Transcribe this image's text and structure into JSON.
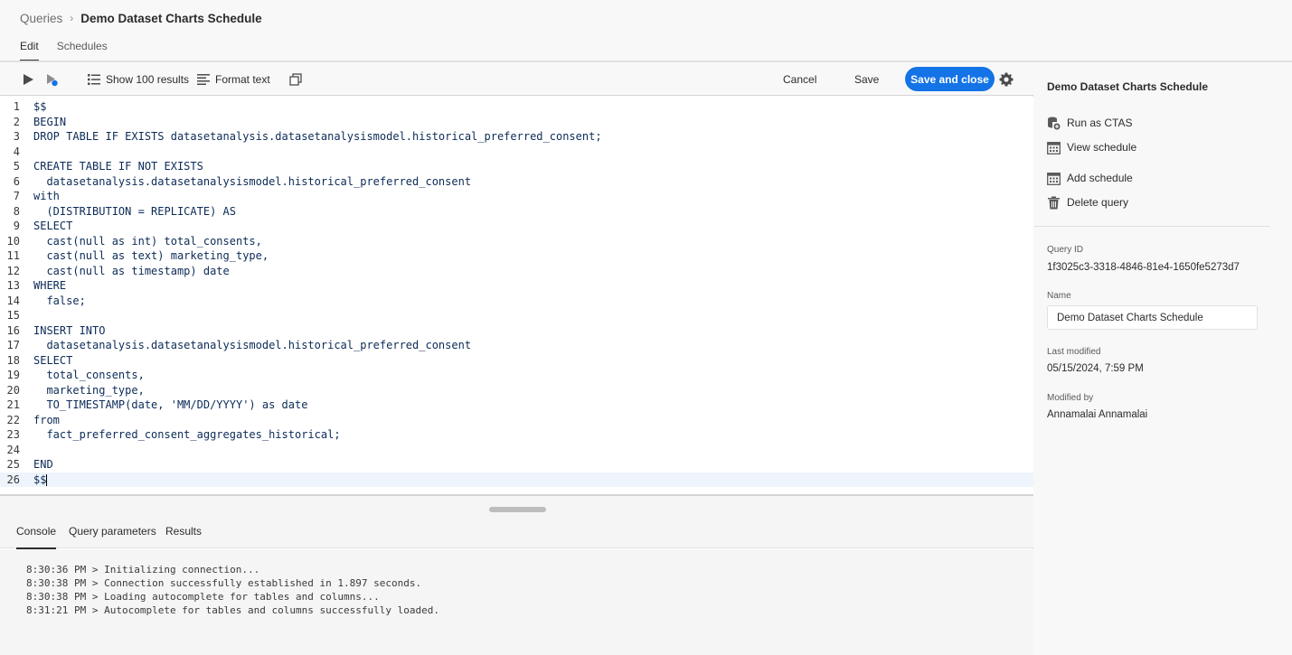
{
  "breadcrumb": {
    "parent": "Queries",
    "separator": "›",
    "current": "Demo Dataset Charts Schedule"
  },
  "page_tabs": [
    {
      "label": "Edit",
      "active": true
    },
    {
      "label": "Schedules",
      "active": false
    }
  ],
  "toolbar": {
    "run_icon": "play-icon",
    "run_selected_icon": "run-selected-icon",
    "show_results_label": "Show 100 results",
    "format_text_label": "Format text",
    "copy_icon": "copy-icon",
    "cancel_label": "Cancel",
    "save_label": "Save",
    "save_close_label": "Save and close",
    "settings_icon": "gear-icon",
    "accent_color": "#1473e6"
  },
  "editor": {
    "lines": [
      "$$",
      "BEGIN",
      "DROP TABLE IF EXISTS datasetanalysis.datasetanalysismodel.historical_preferred_consent;",
      "",
      "CREATE TABLE IF NOT EXISTS",
      "  datasetanalysis.datasetanalysismodel.historical_preferred_consent",
      "with",
      "  (DISTRIBUTION = REPLICATE) AS",
      "SELECT",
      "  cast(null as int) total_consents,",
      "  cast(null as text) marketing_type,",
      "  cast(null as timestamp) date",
      "WHERE",
      "  false;",
      "",
      "INSERT INTO",
      "  datasetanalysis.datasetanalysismodel.historical_preferred_consent",
      "SELECT",
      "  total_consents,",
      "  marketing_type,",
      "  TO_TIMESTAMP(date, 'MM/DD/YYYY') as date",
      "from",
      "  fact_preferred_consent_aggregates_historical;",
      "",
      "END",
      "$$"
    ],
    "current_line": 26
  },
  "bottom_tabs": [
    {
      "label": "Console",
      "active": true
    },
    {
      "label": "Query parameters",
      "active": false
    },
    {
      "label": "Results",
      "active": false
    }
  ],
  "console": [
    "8:30:36 PM > Initializing connection...",
    "8:30:38 PM > Connection successfully established in 1.897 seconds.",
    "8:30:38 PM > Loading autocomplete for tables and columns...",
    "8:31:21 PM > Autocomplete for tables and columns successfully loaded."
  ],
  "side_panel": {
    "title": "Demo Dataset Charts Schedule",
    "actions": [
      {
        "label": "Run as CTAS",
        "icon": "database-add-icon"
      },
      {
        "label": "View schedule",
        "icon": "calendar-icon"
      },
      {
        "label": "Add schedule",
        "icon": "calendar-add-icon"
      },
      {
        "label": "Delete query",
        "icon": "trash-icon"
      }
    ],
    "query_id_label": "Query ID",
    "query_id": "1f3025c3-3318-4846-81e4-1650fe5273d7",
    "name_label": "Name",
    "name_value": "Demo Dataset Charts Schedule",
    "last_modified_label": "Last modified",
    "last_modified": "05/15/2024, 7:59 PM",
    "modified_by_label": "Modified by",
    "modified_by": "Annamalai Annamalai"
  }
}
